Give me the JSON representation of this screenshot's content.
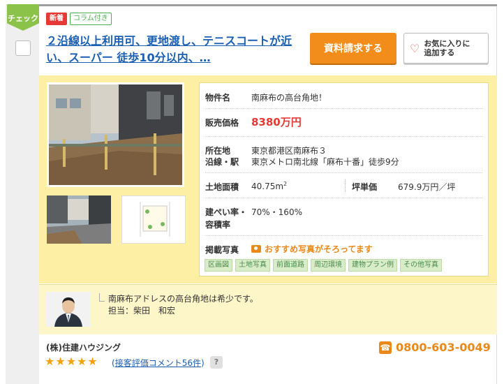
{
  "check_tab": {
    "label": "チェック"
  },
  "badges": {
    "new": "新着",
    "column": "コラム付き"
  },
  "title": "２沿線以上利用可、更地渡し、テニスコートが近い、スーパー 徒歩10分以内、…",
  "buttons": {
    "request": "資料請求する",
    "favorite_line1": "お気に入りに",
    "favorite_line2": "追加する"
  },
  "property": {
    "name_label": "物件名",
    "name_value": "南麻布の高台角地！",
    "price_label": "販売価格",
    "price_value": "8380万円",
    "location_label": "所在地",
    "location_value": "東京都港区南麻布３",
    "station_label": "沿線・駅",
    "station_value": "東京メトロ南北線「麻布十番」徒歩9分",
    "land_area_label": "土地面積",
    "land_area_value": "40.75m",
    "land_area_unit_sup": "2",
    "tsubo_label": "坪単価",
    "tsubo_value": "679.9万円／坪",
    "ratio_label1": "建ぺい率・",
    "ratio_label2": "容積率",
    "ratio_value": "70%・160%",
    "photos_label": "掲載写真",
    "photos_recommend": "おすすめ写真がそろってます"
  },
  "photo_tags": [
    "区画図",
    "土地写真",
    "前面道路",
    "周辺環境",
    "建物プラン例",
    "その他写真"
  ],
  "agent": {
    "comment": "南麻布アドレスの高台角地は希少です。",
    "in_charge_label": "担当：",
    "in_charge_name": "柴田　和宏"
  },
  "company": {
    "name": "(株)住建ハウジング",
    "stars": "★★★★★",
    "reviews_open": "(",
    "reviews_link": "接客評価コメント56件",
    "reviews_close": ")",
    "help": "?",
    "phone": "0800-603-0049"
  },
  "colors": {
    "accent_orange": "#f28c1b",
    "title_blue": "#1a5fb4",
    "price_red": "#e53935",
    "panel_yellow": "#fdf0a4",
    "check_green": "#8bc34a"
  }
}
